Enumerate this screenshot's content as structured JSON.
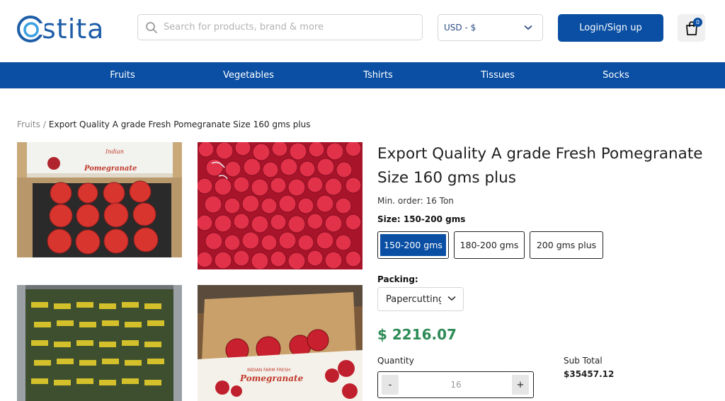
{
  "header": {
    "logo_text": "stita",
    "logo_mark": "O",
    "search_placeholder": "Search for products, brand & more",
    "currency_selected": "USD - $",
    "login_label": "Login/Sign up",
    "cart_count": "0",
    "accent_color": "#0a4fa3"
  },
  "nav": {
    "items": [
      "Fruits",
      "Vegetables",
      "Tshirts",
      "Tissues",
      "Socks"
    ]
  },
  "breadcrumb": {
    "parent": "Fruits",
    "separator": "/",
    "current": "Export Quality A grade Fresh Pomegranate Size 160 gms plus"
  },
  "gallery": {
    "box_label_top": "Indian",
    "box_label_main": "Pomegranate",
    "box2_label_top": "INDIAN FARM FRESH",
    "box2_label_main": "Pomegranate"
  },
  "product": {
    "title": "Export Quality A grade Fresh Pomegranate Size 160 gms plus",
    "min_order": "Min. order: 16 Ton",
    "size_label": "Size: 150-200 gms",
    "sizes": [
      "150-200 gms",
      "180-200 gms",
      "200 gms plus"
    ],
    "selected_size_index": 0,
    "packing_label": "Packing:",
    "packing_selected": "Papercutting",
    "price": "$ 2216.07",
    "price_color": "#2e8b57",
    "quantity_label": "Quantity",
    "quantity_value": "16",
    "minus_label": "-",
    "plus_label": "+",
    "subtotal_label": "Sub Total",
    "subtotal_value": "$35457.12"
  }
}
